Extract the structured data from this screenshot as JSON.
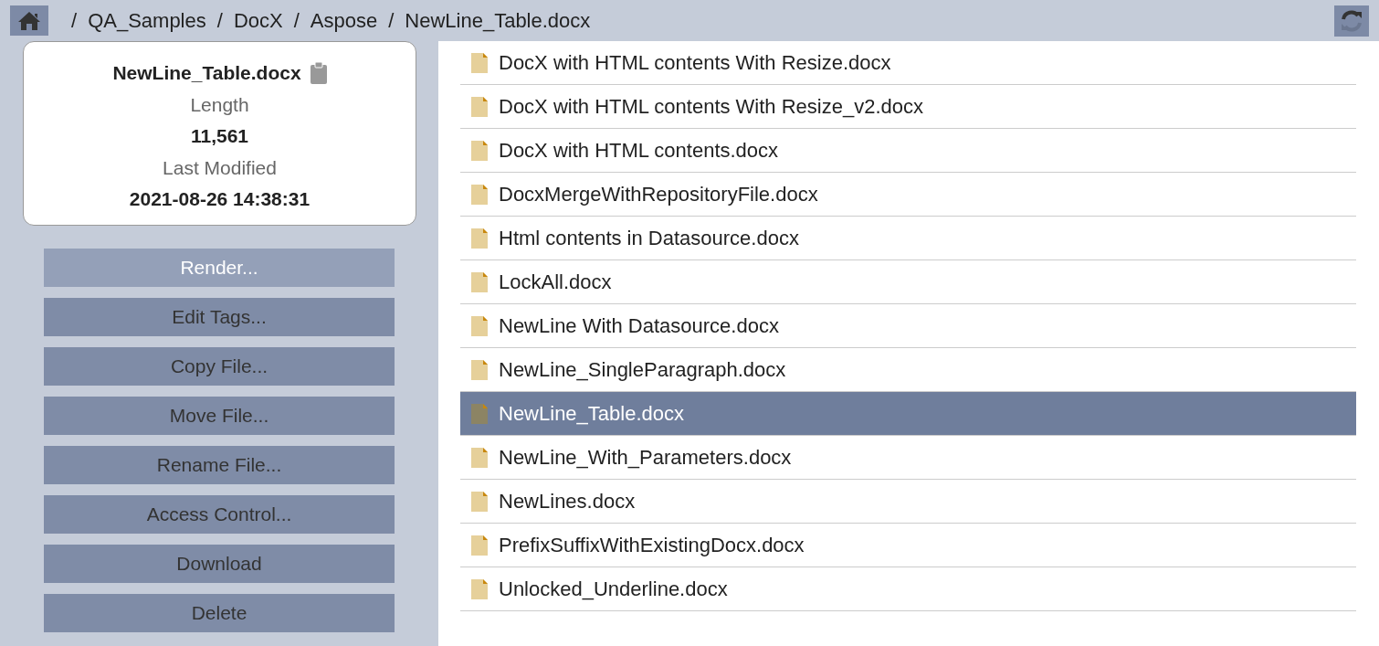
{
  "breadcrumb": {
    "separator": "/",
    "items": [
      "QA_Samples",
      "DocX",
      "Aspose",
      "NewLine_Table.docx"
    ]
  },
  "details": {
    "name": "NewLine_Table.docx",
    "length_label": "Length",
    "length": "11,561",
    "modified_label": "Last Modified",
    "modified": "2021-08-26 14:38:31"
  },
  "actions": [
    {
      "label": "Render...",
      "highlighted": true
    },
    {
      "label": "Edit Tags...",
      "highlighted": false
    },
    {
      "label": "Copy File...",
      "highlighted": false
    },
    {
      "label": "Move File...",
      "highlighted": false
    },
    {
      "label": "Rename File...",
      "highlighted": false
    },
    {
      "label": "Access Control...",
      "highlighted": false
    },
    {
      "label": "Download",
      "highlighted": false
    },
    {
      "label": "Delete",
      "highlighted": false
    }
  ],
  "files": [
    {
      "name": "DocX with HTML contents With Resize.docx",
      "selected": false
    },
    {
      "name": "DocX with HTML contents With Resize_v2.docx",
      "selected": false
    },
    {
      "name": "DocX with HTML contents.docx",
      "selected": false
    },
    {
      "name": "DocxMergeWithRepositoryFile.docx",
      "selected": false
    },
    {
      "name": "Html contents in Datasource.docx",
      "selected": false
    },
    {
      "name": "LockAll.docx",
      "selected": false
    },
    {
      "name": "NewLine With Datasource.docx",
      "selected": false
    },
    {
      "name": "NewLine_SingleParagraph.docx",
      "selected": false
    },
    {
      "name": "NewLine_Table.docx",
      "selected": true
    },
    {
      "name": "NewLine_With_Parameters.docx",
      "selected": false
    },
    {
      "name": "NewLines.docx",
      "selected": false
    },
    {
      "name": "PrefixSuffixWithExistingDocx.docx",
      "selected": false
    },
    {
      "name": "Unlocked_Underline.docx",
      "selected": false
    }
  ]
}
